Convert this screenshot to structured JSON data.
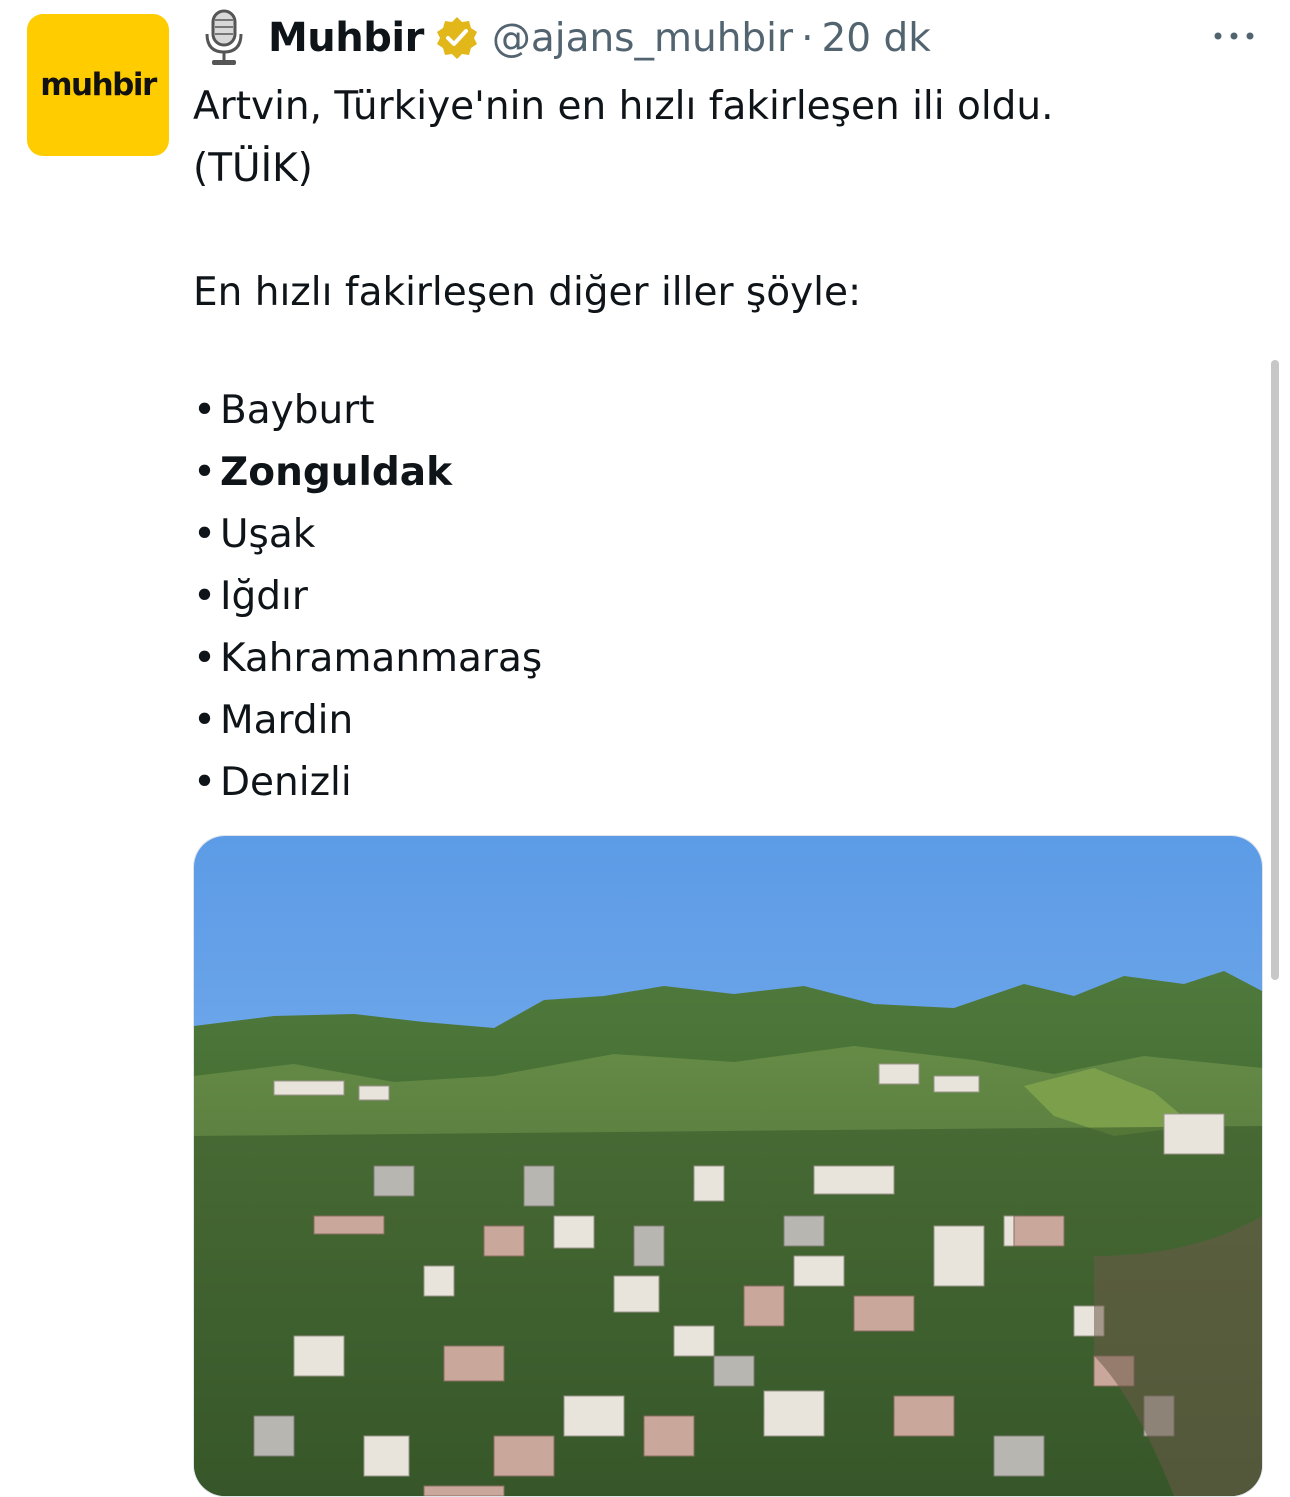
{
  "tweet": {
    "avatar_text": "muhbir",
    "author_name": "Muhbir",
    "handle": "@ajans_muhbir",
    "separator": "·",
    "time": "20 dk",
    "line1": "Artvin, Türkiye'nin en hızlı fakirleşen ili oldu.",
    "line2": "(TÜİK)",
    "line3": "En hızlı fakirleşen diğer iller şöyle:",
    "bullet": "•",
    "cities": [
      "Bayburt",
      "Zonguldak",
      "Uşak",
      "Iğdır",
      "Kahramanmaraş",
      "Mardin",
      "Denizli"
    ]
  },
  "icons": {
    "author_badge": "microphone-icon",
    "verified": "gold-verified-badge-icon",
    "more": "more-options-icon"
  },
  "colors": {
    "avatar_bg": "#ffcc00",
    "verified_gold": "#e2b719",
    "secondary_text": "#536471"
  }
}
